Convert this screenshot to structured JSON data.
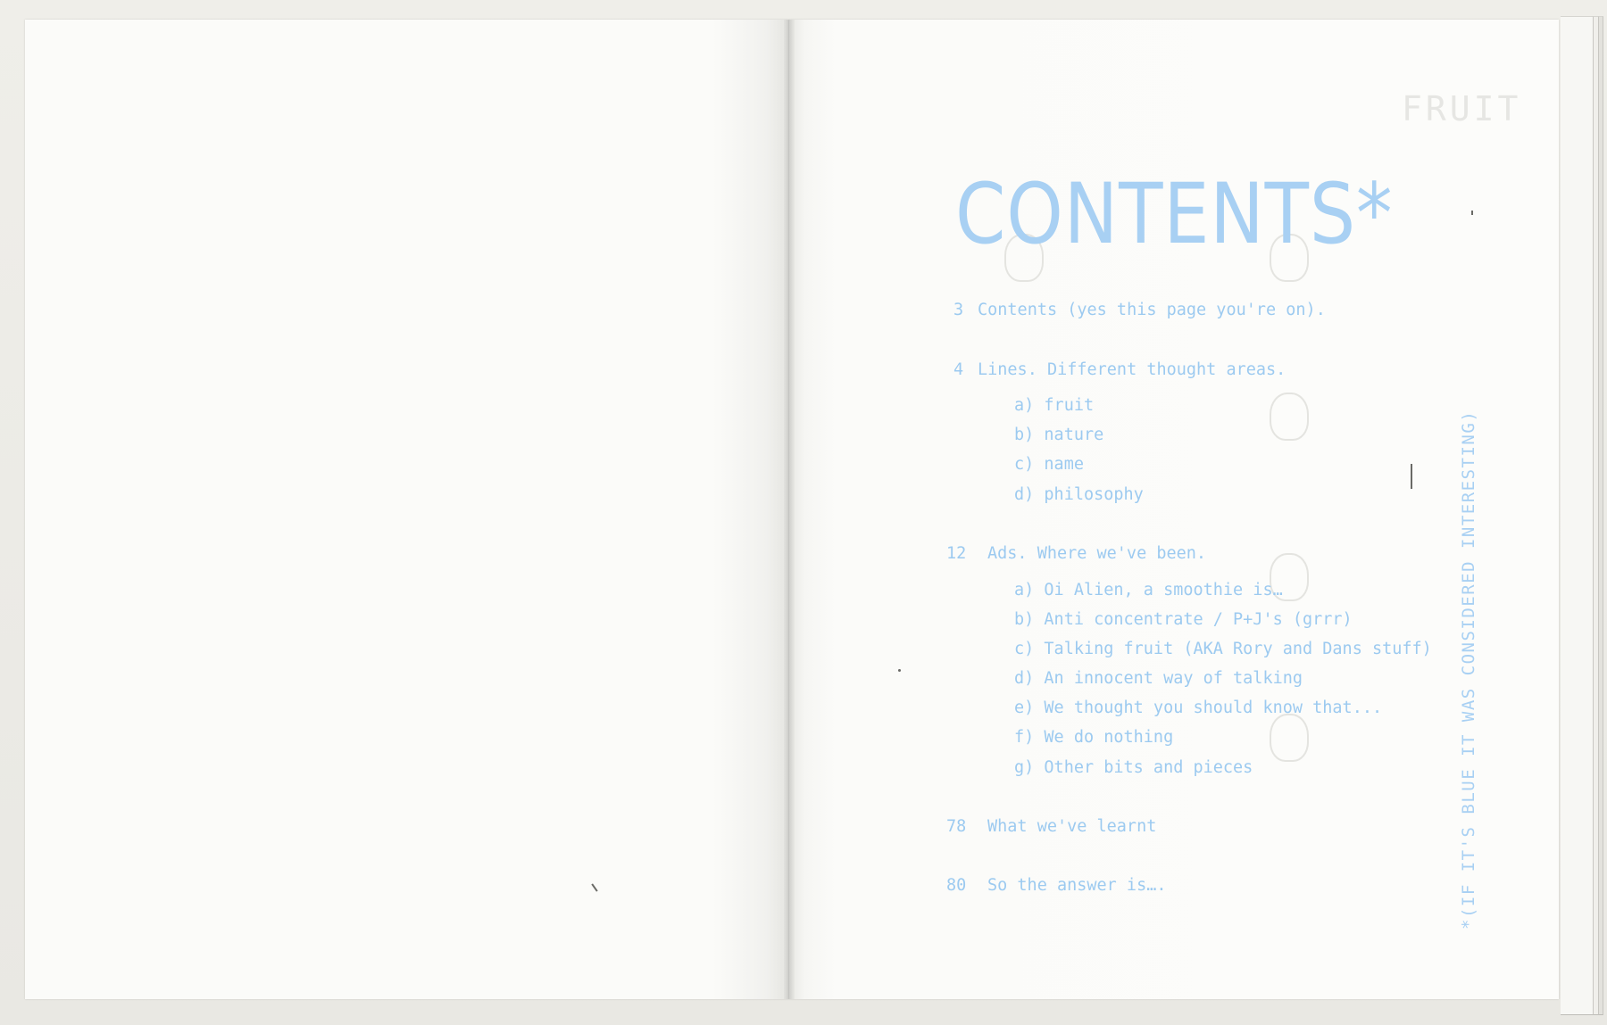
{
  "header": {
    "running_head": "FRUIT"
  },
  "contents": {
    "title": "CONTENTS*",
    "entries": [
      {
        "page": "3",
        "text": "Contents (yes this page you're on)."
      },
      {
        "page": "4",
        "text": "Lines. Different thought areas."
      },
      {
        "page": "",
        "text": "a) fruit"
      },
      {
        "page": "",
        "text": "b) nature"
      },
      {
        "page": "",
        "text": "c) name"
      },
      {
        "page": "",
        "text": "d) philosophy"
      },
      {
        "page": "12",
        "text": "Ads. Where we've been."
      },
      {
        "page": "",
        "text": "a) Oi Alien, a smoothie is…"
      },
      {
        "page": "",
        "text": "b) Anti concentrate / P+J's (grrr)"
      },
      {
        "page": "",
        "text": "c) Talking fruit (AKA Rory and Dans stuff)"
      },
      {
        "page": "",
        "text": "d) An innocent way of talking"
      },
      {
        "page": "",
        "text": "e) We thought you should know that..."
      },
      {
        "page": "",
        "text": "f) We do nothing"
      },
      {
        "page": "",
        "text": "g) Other bits and pieces"
      },
      {
        "page": "78",
        "text": "What we've learnt"
      },
      {
        "page": "80",
        "text": "So the answer is…."
      }
    ]
  },
  "footnote": "*(IF IT'S BLUE IT WAS CONSIDERED INTERESTING)",
  "colors": {
    "ink_blue": "#a8d0f3",
    "paper": "#fbfbf9"
  }
}
